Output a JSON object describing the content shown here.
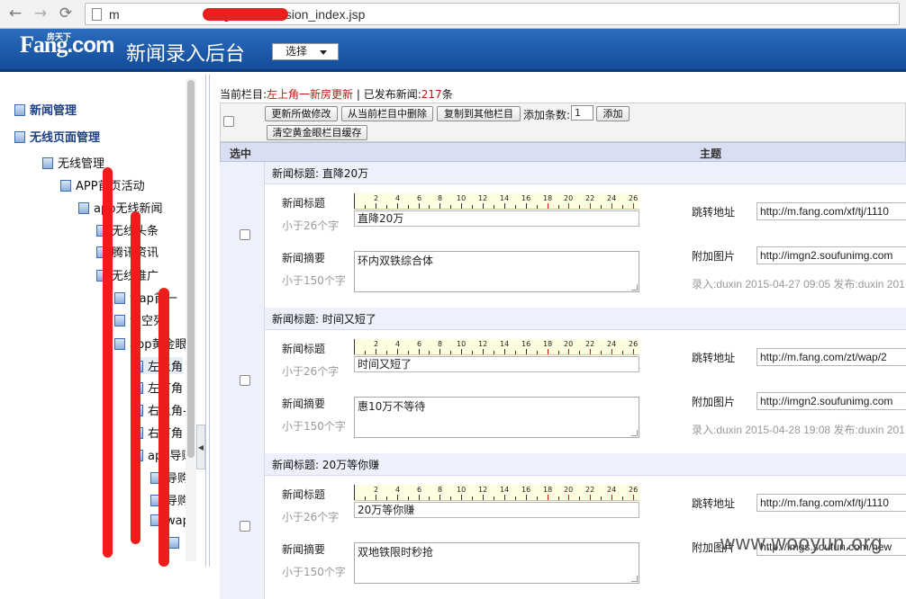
{
  "browser": {
    "back_glyph": "←",
    "forward_glyph": "→",
    "reload_glyph": "⟳",
    "url_prefix": "m",
    "url_suffix": "ng.com/nversion_index.jsp"
  },
  "header": {
    "logo_main": "Fang",
    "logo_com": ".com",
    "logo_small": "房天下",
    "title": "新闻录入后台",
    "select_label": "选择"
  },
  "sidebar": {
    "items": [
      {
        "label": "新闻管理"
      },
      {
        "label": "无线页面管理"
      },
      {
        "label": "无线管理"
      },
      {
        "label": "APP首页活动"
      },
      {
        "label": "app无线新闻"
      },
      {
        "label": "无线头条"
      },
      {
        "label": "腾讯资讯"
      },
      {
        "label": "无线推广"
      },
      {
        "label": "wap首一"
      },
      {
        "label": "清空列"
      },
      {
        "label": "app黄金眼"
      },
      {
        "label": "左上角"
      },
      {
        "label": "左下角"
      },
      {
        "label": "右上角-"
      },
      {
        "label": "右下角"
      },
      {
        "label": "app导购"
      },
      {
        "label": "导购"
      },
      {
        "label": "导购"
      },
      {
        "label": "wap"
      }
    ]
  },
  "status": {
    "current_label": "当前栏目:",
    "current_value": "左上角一新房更新",
    "separator": " | ",
    "published_label": "已发布新闻:",
    "published_count": "217",
    "published_unit": "条"
  },
  "toolbar": {
    "update_all": "更新所做修改",
    "delete_from_column": "从当前栏目中删除",
    "copy_to_other": "复制到其他栏目",
    "add_count_label": "添加条数:",
    "add_count_value": "1",
    "add": "添加",
    "clear_cache": "清空黄金眼栏目缓存"
  },
  "table": {
    "col_select": "选中",
    "col_subject": "主题"
  },
  "form_labels": {
    "news_title": "新闻标题",
    "title_hint": "小于26个字",
    "summary": "新闻摘要",
    "summary_hint": "小于150个字",
    "jump_url": "跳转地址",
    "attach_image": "附加图片"
  },
  "ruler_numbers": [
    "2",
    "4",
    "6",
    "8",
    "10",
    "12",
    "14",
    "16",
    "18",
    "20",
    "22",
    "24",
    "26"
  ],
  "records": [
    {
      "header": "新闻标题: 直降20万",
      "title": "直降20万",
      "summary": "环内双铁综合体",
      "jump_url": "http://m.fang.com/xf/tj/1110",
      "image_url": "http://imgn2.soufunimg.com",
      "meta": "录入:duxin 2015-04-27 09:05 发布:duxin 201"
    },
    {
      "header": "新闻标题: 时间又短了",
      "title": "时间又短了",
      "summary": "惠10万不等待",
      "jump_url": "http://m.fang.com/zt/wap/2",
      "image_url": "http://imgn2.soufunimg.com",
      "meta": "录入:duxin 2015-04-28 19:08 发布:duxin 201"
    },
    {
      "header": "新闻标题: 20万等你赚",
      "title": "20万等你赚",
      "summary": "双地铁限时秒抢",
      "jump_url": "http://m.fang.com/xf/tj/1110",
      "image_url": "http://imgs.soufun.com/new",
      "meta": ""
    }
  ],
  "watermark": "www.wooyun.org",
  "colors": {
    "header_blue": "#1b5aa9",
    "status_red": "#c71313",
    "redaction_red": "#ef1c1c"
  }
}
